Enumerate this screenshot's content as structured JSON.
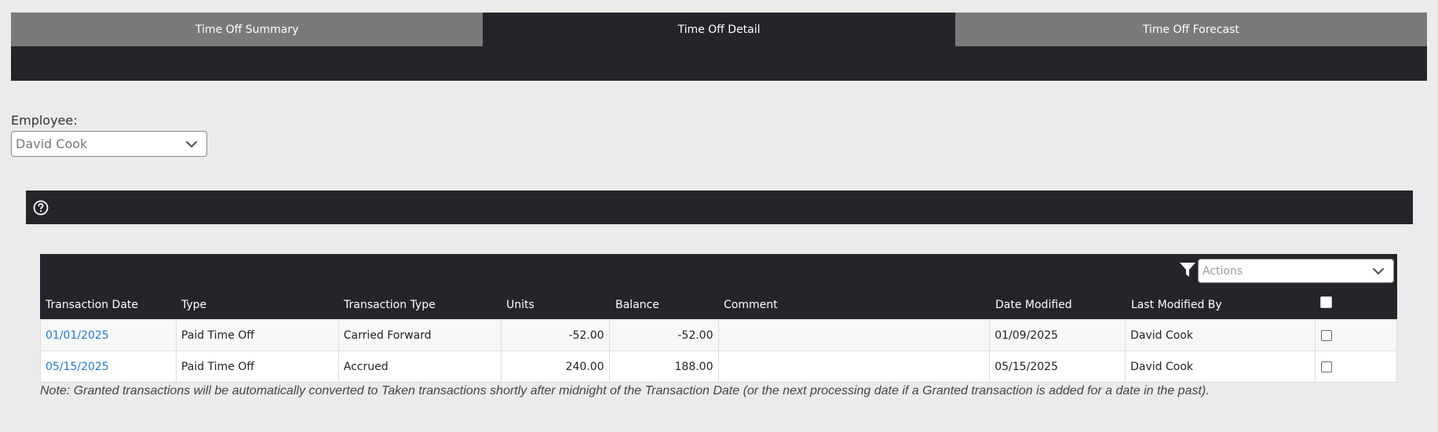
{
  "tabs": [
    {
      "label": "Time Off Summary"
    },
    {
      "label": "Time Off Detail"
    },
    {
      "label": "Time Off Forecast"
    }
  ],
  "employee": {
    "label": "Employee:",
    "value": "David Cook"
  },
  "grid": {
    "actions_placeholder": "Actions",
    "columns": [
      "Transaction Date",
      "Type",
      "Transaction Type",
      "Units",
      "Balance",
      "Comment",
      "Date Modified",
      "Last Modified By"
    ],
    "rows": [
      {
        "date": "01/01/2025",
        "type": "Paid Time Off",
        "transaction_type": "Carried Forward",
        "units": "-52.00",
        "balance": "-52.00",
        "comment": "",
        "date_modified": "01/09/2025",
        "modified_by": "David Cook"
      },
      {
        "date": "05/15/2025",
        "type": "Paid Time Off",
        "transaction_type": "Accrued",
        "units": "240.00",
        "balance": "188.00",
        "comment": "",
        "date_modified": "05/15/2025",
        "modified_by": "David Cook"
      }
    ]
  },
  "note": "Note: Granted transactions will be automatically converted to Taken transactions shortly after midnight of the Transaction Date (or the next processing date if a Granted transaction is added for a date in the past).",
  "icons": {
    "help": "help-circle-icon",
    "filter": "filter-icon",
    "dropdown": "chevron-down-icon"
  },
  "colors": {
    "dark_bar": "#23252a",
    "inactive_tab": "#7a7a7a",
    "link": "#1e7bd0",
    "page_bg": "#ebebeb"
  }
}
